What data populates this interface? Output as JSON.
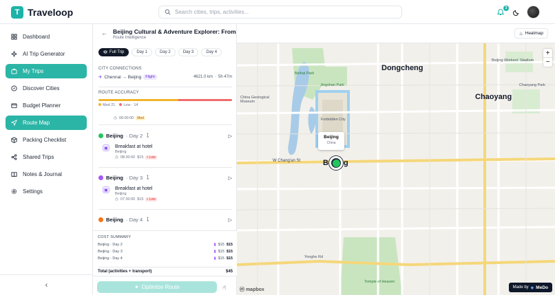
{
  "app": {
    "name": "Traveloop",
    "logo_letter": "T"
  },
  "search": {
    "placeholder": "Search cities, trips, activities..."
  },
  "notifications": {
    "count": "3"
  },
  "sidebar": {
    "items": [
      {
        "label": "Dashboard",
        "icon": "grid-icon"
      },
      {
        "label": "AI Trip Generator",
        "icon": "sparkle-icon"
      },
      {
        "label": "My Trips",
        "icon": "suitcase-icon",
        "active": true
      },
      {
        "label": "Discover Cities",
        "icon": "compass-icon"
      },
      {
        "label": "Budget Planner",
        "icon": "wallet-icon"
      },
      {
        "label": "Route Map",
        "icon": "navigation-icon",
        "active": true
      },
      {
        "label": "Packing Checklist",
        "icon": "box-icon"
      },
      {
        "label": "Shared Trips",
        "icon": "share-icon"
      },
      {
        "label": "Notes & Journal",
        "icon": "book-icon"
      },
      {
        "label": "Settings",
        "icon": "gear-icon"
      }
    ],
    "collapse_label": "‹"
  },
  "panel": {
    "title": "Beijing Cultural & Adventure Explorer: From Imperial Palaces to the Great Wall",
    "subtitle": "Route Intelligence",
    "tabs": [
      "Full Trip",
      "Day 1",
      "Day 2",
      "Day 3",
      "Day 4"
    ],
    "city_connections": {
      "label": "CITY CONNECTIONS",
      "route": "Chennai → Beijing",
      "mode": "Flight",
      "distance": "4621.0 km",
      "duration": "5h 47m"
    },
    "route_accuracy": {
      "label": "ROUTE ACCURACY",
      "med_label": "Med",
      "med_count": "21",
      "low_label": "Low",
      "low_count": "14",
      "med_fraction": 0.6,
      "low_fraction": 0.4
    },
    "prev_item": {
      "time": "06:00:00",
      "tag": "Med"
    },
    "days": [
      {
        "city": "Beijing",
        "day": "· Day 2",
        "color": "#22c55e",
        "activity": "Breakfast at hotel",
        "activity_city": "Beijing",
        "time": "08:30:00",
        "price": "$15",
        "tag": "Low"
      },
      {
        "city": "Beijing",
        "day": "· Day 3",
        "color": "#a855f7",
        "activity": "Breakfast at hotel",
        "activity_city": "Beijing",
        "time": "07:30:00",
        "price": "$15",
        "tag": "Low"
      },
      {
        "city": "Beijing",
        "day": "· Day 4",
        "color": "#f97316"
      }
    ],
    "cost_summary": {
      "label": "COST SUMMARY",
      "rows": [
        {
          "name": "Beijing · Day 2",
          "chip": "$15",
          "amount": "$15"
        },
        {
          "name": "Beijing · Day 3",
          "chip": "$15",
          "amount": "$15"
        },
        {
          "name": "Beijing · Day 4",
          "chip": "$15",
          "amount": "$15"
        }
      ],
      "total_label": "Total (activities + transport)",
      "total_value": "$45"
    },
    "optimize_label": "Optimize Route"
  },
  "map": {
    "heatmap_label": "Heatmap",
    "zoom_in": "+",
    "zoom_out": "−",
    "popup_city": "Beijing",
    "popup_country": "China",
    "made_by_label": "Made by",
    "made_by_brand": "MeDo",
    "attribution": "mapbox",
    "district_labels": [
      "Dongcheng",
      "Chaoyang"
    ],
    "road_label": "W Chang'an St",
    "marker_label": "Beijing",
    "park_labels": [
      "Beihai Park",
      "Jingshan Park",
      "Forbidden City",
      "Temple of Heaven"
    ],
    "other_labels": [
      "China Geological Museum",
      "Beijing Workers' Stadium",
      "Yonghe Rd",
      "Chaoyang Park"
    ]
  }
}
